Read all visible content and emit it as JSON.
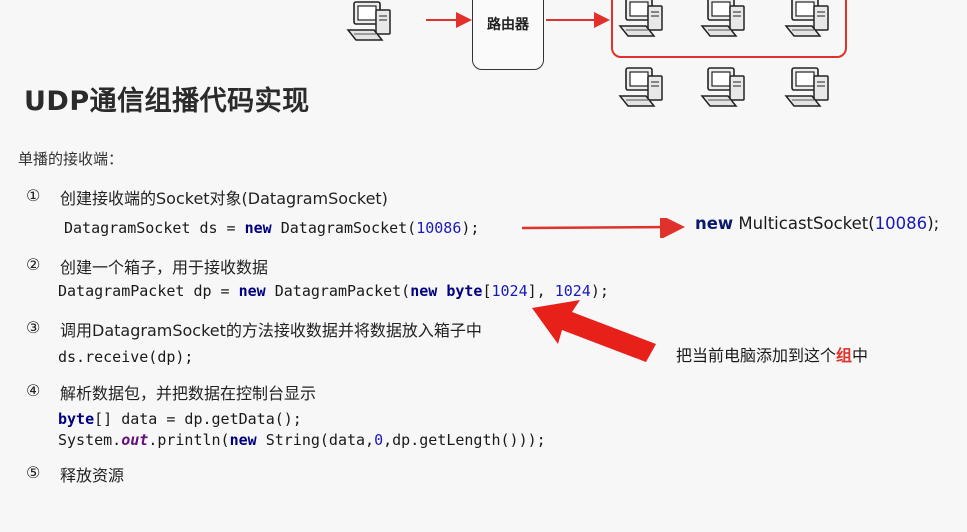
{
  "diagram": {
    "router_label": "路由器"
  },
  "title": "UDP通信组播代码实现",
  "subtitle": "单播的接收端：",
  "steps": [
    {
      "num": "①",
      "text": "创建接收端的Socket对象(DatagramSocket)"
    },
    {
      "num": "②",
      "text": "创建一个箱子，用于接收数据"
    },
    {
      "num": "③",
      "text": "调用DatagramSocket的方法接收数据并将数据放入箱子中"
    },
    {
      "num": "④",
      "text": "解析数据包，并把数据在控制台显示"
    },
    {
      "num": "⑤",
      "text": "释放资源"
    }
  ],
  "code": {
    "line1": {
      "a": "DatagramSocket ds = ",
      "kw": "new",
      "b": " DatagramSocket(",
      "n": "10086",
      "c": ");"
    },
    "line2": {
      "a": "DatagramPacket dp = ",
      "kw1": "new",
      "b": " DatagramPacket(",
      "kw2": "new",
      "c": " ",
      "kw3": "byte",
      "d": "[",
      "n1": "1024",
      "e": "], ",
      "n2": "1024",
      "f": ");"
    },
    "line3": "ds.receive(dp);",
    "line4": {
      "kw": "byte",
      "a": "[] data = dp.getData();"
    },
    "line5": {
      "a": "System.",
      "fld": "out",
      "b": ".println(",
      "kw": "new",
      "c": " String(data,",
      "n": "0",
      "d": ",dp.getLength()));"
    }
  },
  "multicast": {
    "kw": "new",
    "a": " MulticastSocket(",
    "n": "10086",
    "b": ");"
  },
  "note": {
    "a": "把当前电脑添加到这个",
    "hl": "组",
    "b": "中"
  },
  "colors": {
    "accent": "#e0322a",
    "keyword": "#000080",
    "number": "#1a1ab8"
  }
}
